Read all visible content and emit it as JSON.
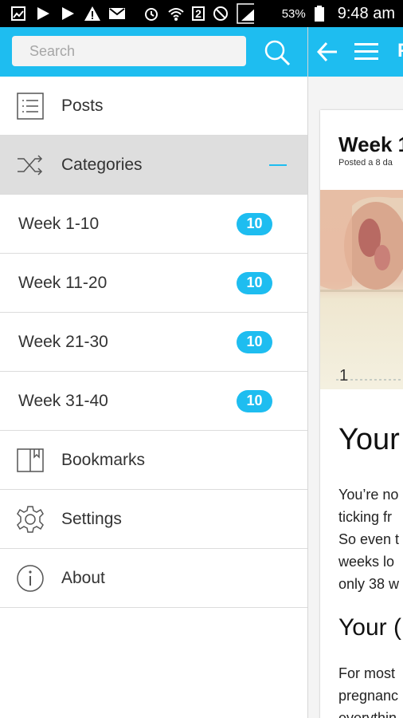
{
  "status_bar": {
    "battery_percent": "53%",
    "time": "9:48 am",
    "notification_count": "2"
  },
  "search": {
    "placeholder": "Search"
  },
  "menu": {
    "posts": "Posts",
    "categories": "Categories",
    "categories_items": [
      {
        "label": "Week 1-10",
        "count": "10"
      },
      {
        "label": "Week 11-20",
        "count": "10"
      },
      {
        "label": "Week 21-30",
        "count": "10"
      },
      {
        "label": "Week 31-40",
        "count": "10"
      }
    ],
    "bookmarks": "Bookmarks",
    "settings": "Settings",
    "about": "About"
  },
  "appbar": {
    "title_fragment": "F"
  },
  "post": {
    "title_fragment": "Week 1",
    "meta_fragment": "Posted a 8 da",
    "image_caption": "1",
    "heading1_fragment": "Your",
    "paragraph1": [
      "You’re no",
      "ticking fr",
      "So even t",
      "weeks lo",
      "only 38 w"
    ],
    "heading2_fragment": "Your (",
    "paragraph2": [
      "For most",
      "pregnanc",
      "everythin"
    ]
  },
  "colors": {
    "accent": "#1ebdf0",
    "active_row": "#dedede"
  }
}
